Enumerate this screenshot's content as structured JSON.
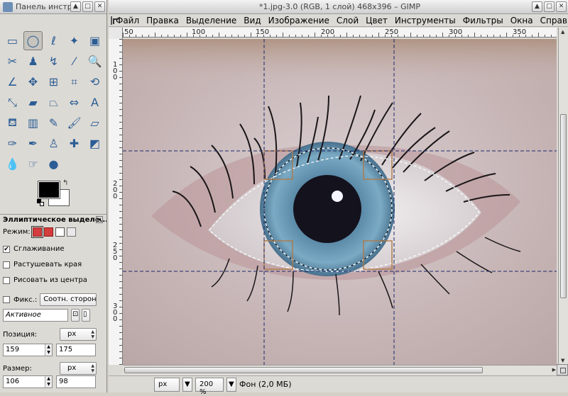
{
  "toolbox": {
    "title": "Панель инстру",
    "tools": [
      {
        "name": "rect-select-icon",
        "glyph": "▭"
      },
      {
        "name": "ellipse-select-icon",
        "glyph": "◯",
        "active": true
      },
      {
        "name": "lasso-select-icon",
        "glyph": "ℓ"
      },
      {
        "name": "fuzzy-select-icon",
        "glyph": "✦"
      },
      {
        "name": "color-select-icon",
        "glyph": "▣"
      },
      {
        "name": "scissors-icon",
        "glyph": "✂"
      },
      {
        "name": "foreground-select-icon",
        "glyph": "♟"
      },
      {
        "name": "paths-icon",
        "glyph": "↯"
      },
      {
        "name": "color-picker-icon",
        "glyph": "⁄"
      },
      {
        "name": "zoom-icon",
        "glyph": "🔍"
      },
      {
        "name": "measure-icon",
        "glyph": "∠"
      },
      {
        "name": "move-icon",
        "glyph": "✥"
      },
      {
        "name": "align-icon",
        "glyph": "⊞"
      },
      {
        "name": "crop-icon",
        "glyph": "⌗"
      },
      {
        "name": "rotate-icon",
        "glyph": "⟲"
      },
      {
        "name": "scale-icon",
        "glyph": "⤡"
      },
      {
        "name": "shear-icon",
        "glyph": "▰"
      },
      {
        "name": "perspective-icon",
        "glyph": "⏢"
      },
      {
        "name": "flip-icon",
        "glyph": "⇔"
      },
      {
        "name": "text-icon",
        "glyph": "A"
      },
      {
        "name": "bucket-fill-icon",
        "glyph": "⛾"
      },
      {
        "name": "blend-icon",
        "glyph": "▥"
      },
      {
        "name": "pencil-icon",
        "glyph": "✎"
      },
      {
        "name": "paintbrush-icon",
        "glyph": "🖌"
      },
      {
        "name": "eraser-icon",
        "glyph": "▱"
      },
      {
        "name": "airbrush-icon",
        "glyph": "✑"
      },
      {
        "name": "ink-icon",
        "glyph": "✒"
      },
      {
        "name": "clone-icon",
        "glyph": "♙"
      },
      {
        "name": "heal-icon",
        "glyph": "✚"
      },
      {
        "name": "perspective-clone-icon",
        "glyph": "◩"
      },
      {
        "name": "blur-icon",
        "glyph": "💧"
      },
      {
        "name": "smudge-icon",
        "glyph": "☞"
      },
      {
        "name": "dodge-burn-icon",
        "glyph": "●"
      }
    ],
    "options": {
      "title": "Эллиптическое выделе...",
      "mode_label": "Режим:",
      "antialias_label": "Сглаживание",
      "antialias_checked": true,
      "feather_label": "Растушевать края",
      "feather_checked": false,
      "from_center_label": "Рисовать из центра",
      "from_center_checked": false,
      "fixed_label": "Фикс.:",
      "fixed_checked": false,
      "fixed_combo": "Соотн. сторон",
      "active_value": "Активное",
      "position_label": "Позиция:",
      "position_unit": "px",
      "position_x": "159",
      "position_y": "175",
      "size_label": "Размер:",
      "size_unit": "px",
      "size_w": "106",
      "size_h": "98"
    }
  },
  "image_window": {
    "title": "*1.jpg-3.0 (RGB, 1 слой) 468x396 – GIMP",
    "menus": [
      "Файл",
      "Правка",
      "Выделение",
      "Вид",
      "Изображение",
      "Слой",
      "Цвет",
      "Инструменты",
      "Фильтры",
      "Окна",
      "Справка"
    ],
    "hruler_labels": [
      "50",
      "100",
      "150",
      "200",
      "250",
      "300",
      "350"
    ],
    "vruler_labels": [
      "100",
      "150",
      "200",
      "250",
      "300"
    ],
    "status": {
      "unit": "px",
      "zoom": "200 %",
      "info": "Фон (2,0 МБ)"
    }
  }
}
